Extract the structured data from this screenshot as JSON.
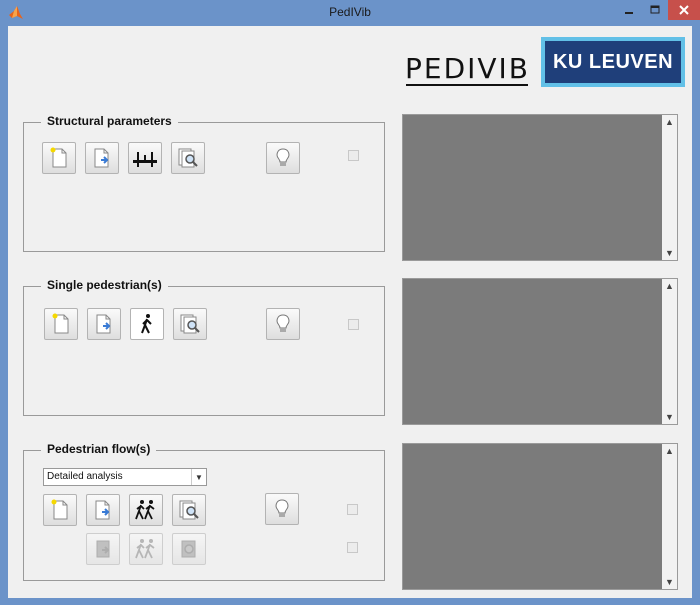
{
  "window": {
    "title": "PedIVib",
    "icons": {
      "app": "matlab-icon",
      "minimize": "minimize-icon",
      "maximize": "maximize-icon",
      "close": "close-icon"
    }
  },
  "logos": {
    "pedivib": "PEDIVIB",
    "ku_leuven": "KU LEUVEN"
  },
  "panels": {
    "structural": {
      "title": "Structural parameters"
    },
    "single": {
      "title": "Single pedestrian(s)"
    },
    "flow": {
      "title": "Pedestrian flow(s)",
      "analysis_select": {
        "selected": "Detailed analysis"
      }
    }
  },
  "colors": {
    "accent_blue": "#6b93c9",
    "ku_navy": "#1f3f7a",
    "ku_cyan": "#62c0e7",
    "output_gray": "#7b7b7b",
    "close_red": "#c7504b"
  }
}
